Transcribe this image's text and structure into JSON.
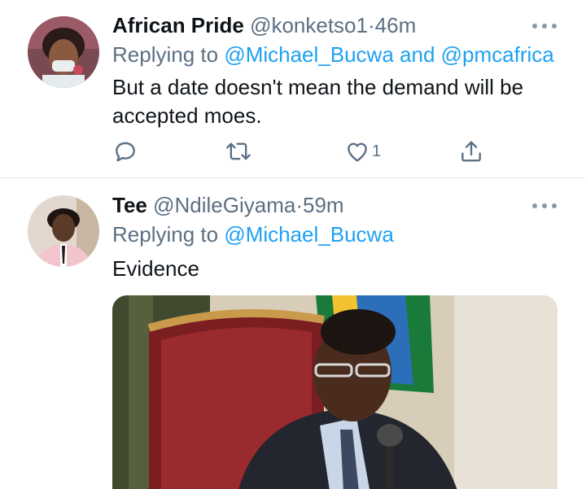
{
  "tweets": [
    {
      "display_name": "African Pride",
      "handle": "@konketso1",
      "separator": "·",
      "time": "46m",
      "replying_prefix": "Replying to",
      "reply_to_1": "@Michael_Bucwa",
      "reply_joiner": "and",
      "reply_to_2": "@pmcafrica",
      "text": "But a date doesn't mean the demand will be accepted moes.",
      "like_count": "1"
    },
    {
      "display_name": "Tee",
      "handle": "@NdileGiyama",
      "separator": "·",
      "time": "59m",
      "replying_prefix": "Replying to",
      "reply_to_1": "@Michael_Bucwa",
      "text": "Evidence"
    }
  ],
  "icons": {
    "reply": "reply-icon",
    "retweet": "retweet-icon",
    "like": "heart-icon",
    "share": "share-icon",
    "more": "more-icon"
  },
  "colors": {
    "link": "#1da1f2",
    "secondary_text": "#5b7083",
    "primary_text": "#0f1419",
    "divider": "#e6ecf0"
  }
}
